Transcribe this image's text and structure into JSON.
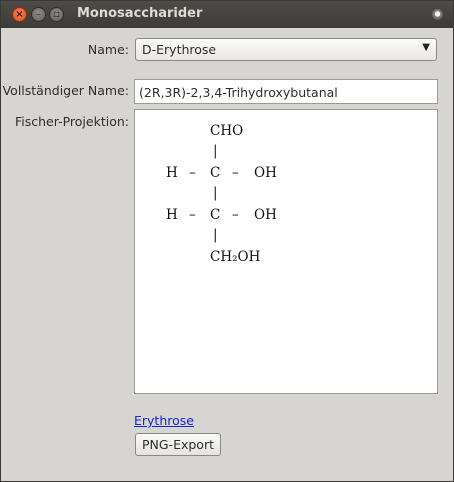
{
  "window": {
    "title": "Monosaccharider",
    "close_glyph": "×",
    "min_glyph": "–",
    "max_glyph": "▫"
  },
  "form": {
    "name_label": "Name:",
    "name_value": "D-Erythrose",
    "full_name_label": "Vollständiger Name:",
    "full_name_value": "(2R,3R)-2,3,4-Trihydroxybutanal",
    "fischer_label": "Fischer-Projektion:"
  },
  "fischer": {
    "top_group": "CHO",
    "bond": "|",
    "rows": [
      {
        "left": "H",
        "dash": "–",
        "center": "C",
        "right": "OH"
      },
      {
        "left": "H",
        "dash": "–",
        "center": "C",
        "right": "OH"
      }
    ],
    "bottom_group": "CH₂OH"
  },
  "footer": {
    "link_text": "Erythrose",
    "export_label": "PNG-Export"
  },
  "icons": {
    "dropdown": "▼"
  }
}
